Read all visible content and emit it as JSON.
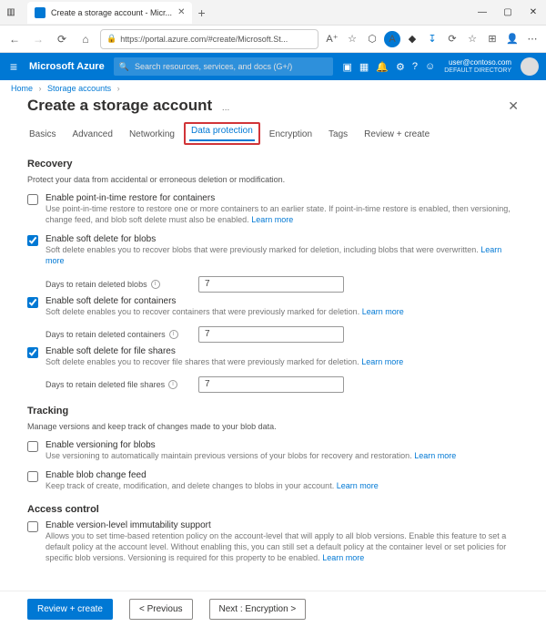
{
  "browser": {
    "tab_title": "Create a storage account - Micr...",
    "url": "https://portal.azure.com/#create/Microsoft.St..."
  },
  "az_header": {
    "brand": "Microsoft Azure",
    "search_placeholder": "Search resources, services, and docs (G+/)",
    "user_email": "user@contoso.com",
    "user_dir": "DEFAULT DIRECTORY"
  },
  "breadcrumb": {
    "items": [
      "Home",
      "Storage accounts"
    ]
  },
  "page": {
    "title": "Create a storage account",
    "more": "..."
  },
  "tabs": {
    "items": [
      "Basics",
      "Advanced",
      "Networking",
      "Data protection",
      "Encryption",
      "Tags",
      "Review + create"
    ],
    "active": 3
  },
  "sections": {
    "recovery": {
      "heading": "Recovery",
      "desc": "Protect your data from accidental or erroneous deletion or modification.",
      "pitr": {
        "label": "Enable point-in-time restore for containers",
        "desc": "Use point-in-time restore to restore one or more containers to an earlier state. If point-in-time restore is enabled, then versioning, change feed, and blob soft delete must also be enabled.",
        "learn": "Learn more",
        "checked": false
      },
      "blob_sd": {
        "label": "Enable soft delete for blobs",
        "desc": "Soft delete enables you to recover blobs that were previously marked for deletion, including blobs that were overwritten.",
        "learn": "Learn more",
        "checked": true,
        "days_label": "Days to retain deleted blobs",
        "days_value": "7"
      },
      "cont_sd": {
        "label": "Enable soft delete for containers",
        "desc": "Soft delete enables you to recover containers that were previously marked for deletion.",
        "learn": "Learn more",
        "checked": true,
        "days_label": "Days to retain deleted containers",
        "days_value": "7"
      },
      "file_sd": {
        "label": "Enable soft delete for file shares",
        "desc": "Soft delete enables you to recover file shares that were previously marked for deletion.",
        "learn": "Learn more",
        "checked": true,
        "days_label": "Days to retain deleted file shares",
        "days_value": "7"
      }
    },
    "tracking": {
      "heading": "Tracking",
      "desc": "Manage versions and keep track of changes made to your blob data.",
      "versioning": {
        "label": "Enable versioning for blobs",
        "desc": "Use versioning to automatically maintain previous versions of your blobs for recovery and restoration.",
        "learn": "Learn more",
        "checked": false
      },
      "changefeed": {
        "label": "Enable blob change feed",
        "desc": "Keep track of create, modification, and delete changes to blobs in your account.",
        "learn": "Learn more",
        "checked": false
      }
    },
    "access": {
      "heading": "Access control",
      "immutability": {
        "label": "Enable version-level immutability support",
        "desc": "Allows you to set time-based retention policy on the account-level that will apply to all blob versions. Enable this feature to set a default policy at the account level. Without enabling this, you can still set a default policy at the container level or set policies for specific blob versions. Versioning is required for this property to be enabled.",
        "learn": "Learn more",
        "checked": false
      }
    }
  },
  "footer": {
    "review": "Review + create",
    "prev": "< Previous",
    "next": "Next : Encryption >"
  }
}
